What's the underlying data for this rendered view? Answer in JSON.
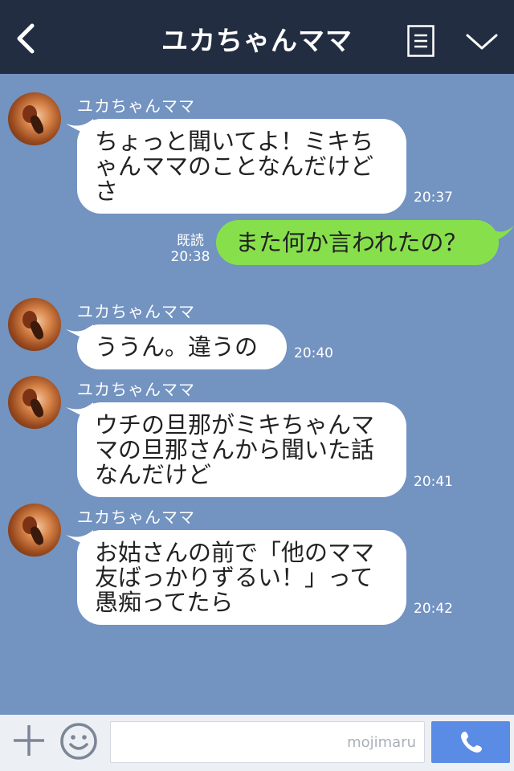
{
  "header": {
    "title": "ユカちゃんママ",
    "back_icon": "back-chevron-icon",
    "menu_icon": "menu-list-icon",
    "dropdown_icon": "chevron-down-icon"
  },
  "messages": [
    {
      "sender": "ユカちゃんママ",
      "text": "ちょっと聞いてよ！ミキちゃんママのことなんだけどさ",
      "time": "20:37"
    },
    {
      "sender": "me",
      "text": "また何か言われたの？",
      "read": "既読",
      "time": "20:38"
    },
    {
      "sender": "ユカちゃんママ",
      "text": "ううん。違うの",
      "time": "20:40"
    },
    {
      "sender": "ユカちゃんママ",
      "text": "ウチの旦那がミキちゃんママの旦那さんから聞いた話なんだけど",
      "time": "20:41"
    },
    {
      "sender": "ユカちゃんママ",
      "text": "お姑さんの前で「他のママ友ばっかりずるい！」って愚痴ってたら",
      "time": "20:42"
    }
  ],
  "input_bar": {
    "placeholder": "mojimaru",
    "plus_icon": "plus-icon",
    "emoji_icon": "smile-icon",
    "call_icon": "phone-icon"
  },
  "colors": {
    "header_bg": "#232d41",
    "chat_bg": "#7393c1",
    "outgoing_bubble": "#87e04b",
    "incoming_bubble": "#ffffff",
    "call_button": "#5a8ce6"
  }
}
